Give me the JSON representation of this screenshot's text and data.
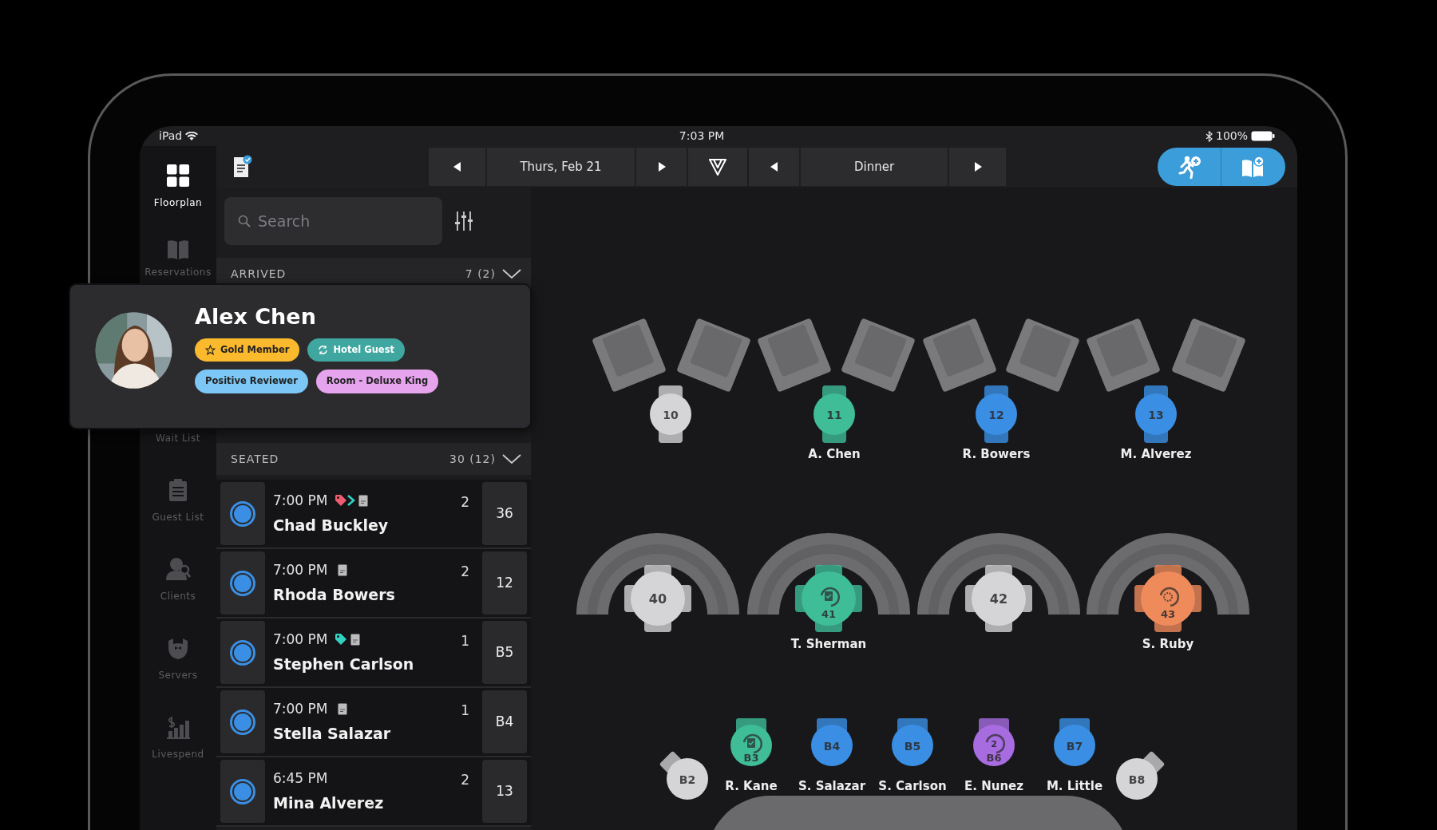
{
  "status_bar": {
    "device": "iPad",
    "time": "7:03 PM",
    "battery": "100%"
  },
  "sidebar": {
    "items": [
      {
        "label": "Floorplan",
        "selected": true
      },
      {
        "label": "Reservations",
        "selected": false
      },
      {
        "label": "Wait List",
        "selected": false
      },
      {
        "label": "Guest List",
        "selected": false
      },
      {
        "label": "Clients",
        "selected": false
      },
      {
        "label": "Servers",
        "selected": false
      },
      {
        "label": "Livespend",
        "selected": false
      }
    ]
  },
  "toolbar": {
    "date": "Thurs, Feb 21",
    "shift": "Dinner"
  },
  "search": {
    "placeholder": "Search"
  },
  "sections": [
    {
      "title": "ARRIVED",
      "count": "7 (2)"
    },
    {
      "title": "SEATED",
      "count": "30 (12)"
    }
  ],
  "guest_card": {
    "name": "Alex Chen",
    "tags": [
      {
        "label": "Gold Member",
        "color": "#fbb92e",
        "kind": "starred"
      },
      {
        "label": "Hotel Guest",
        "color": "#3fa7a0",
        "kind": "linked"
      },
      {
        "label": "Positive Reviewer",
        "color": "#7cc7f5",
        "kind": "plain"
      },
      {
        "label": "Room - Deluxe King",
        "color": "#e7a4ee",
        "kind": "plain"
      }
    ]
  },
  "reservations": [
    {
      "time": "7:00 PM",
      "name": "Chad Buckley",
      "party": "2",
      "table": "36",
      "tags": [
        {
          "kind": "tag",
          "color": "#ef5b6f"
        },
        {
          "kind": "chevron",
          "color": "#33d2c0"
        }
      ],
      "note": true
    },
    {
      "time": "7:00 PM",
      "name": "Rhoda Bowers",
      "party": "2",
      "table": "12",
      "note": true
    },
    {
      "time": "7:00 PM",
      "name": "Stephen Carlson",
      "party": "1",
      "table": "B5",
      "tags": [
        {
          "kind": "tag",
          "color": "#33d2c0"
        }
      ],
      "note": true
    },
    {
      "time": "7:00 PM",
      "name": "Stella Salazar",
      "party": "1",
      "table": "B4",
      "note": true
    },
    {
      "time": "6:45 PM",
      "name": "Mina Alverez",
      "party": "2",
      "table": "13",
      "note": false
    }
  ],
  "floor": {
    "tables": [
      {
        "label": "10",
        "kind": "round",
        "color": "#d5d5d7"
      },
      {
        "label": "11",
        "kind": "round",
        "color": "#3fbd97",
        "guest": "A. Chen"
      },
      {
        "label": "12",
        "kind": "round",
        "color": "#3a8fe4",
        "guest": "R. Bowers"
      },
      {
        "label": "13",
        "kind": "round",
        "color": "#3a8fe4",
        "guest": "M. Alverez"
      },
      {
        "label": "40",
        "kind": "booth",
        "color": "#d5d5d7"
      },
      {
        "label": "41",
        "kind": "booth",
        "color": "#3fbd97",
        "check_presented": true,
        "guest": "T. Sherman"
      },
      {
        "label": "42",
        "kind": "booth",
        "color": "#d5d5d7"
      },
      {
        "label": "43",
        "kind": "booth",
        "color": "#ef8a5b",
        "dessert": true,
        "guest": "S. Ruby"
      },
      {
        "label": "B2",
        "kind": "bar",
        "color": "#d5d5d7"
      },
      {
        "label": "B3",
        "kind": "bar",
        "color": "#3fbd97",
        "check_presented": true,
        "guest": "R. Kane"
      },
      {
        "label": "B4",
        "kind": "bar",
        "color": "#3a8fe4",
        "guest": "S. Salazar"
      },
      {
        "label": "B5",
        "kind": "bar",
        "color": "#3a8fe4",
        "guest": "S. Carlson"
      },
      {
        "label": "B6",
        "kind": "bar",
        "color": "#a66ce0",
        "course": "2",
        "guest": "E. Nunez"
      },
      {
        "label": "B7",
        "kind": "bar",
        "color": "#3a8fe4",
        "guest": "M. Little"
      },
      {
        "label": "B8",
        "kind": "bar",
        "color": "#d5d5d7"
      }
    ]
  }
}
